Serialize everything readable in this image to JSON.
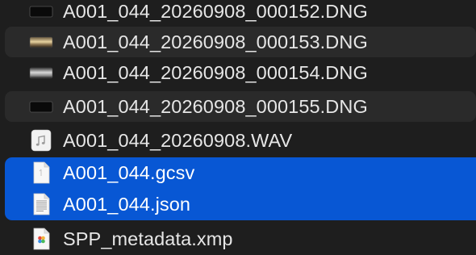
{
  "files": [
    {
      "name": "A001_044_20260908_000152.DNG",
      "icon": "dng-thumbnail-icon"
    },
    {
      "name": "A001_044_20260908_000153.DNG",
      "icon": "dng-thumbnail-icon"
    },
    {
      "name": "A001_044_20260908_000154.DNG",
      "icon": "dng-thumbnail-icon"
    },
    {
      "name": "A001_044_20260908_000155.DNG",
      "icon": "dng-thumbnail-icon"
    },
    {
      "name": "A001_044_20260908.WAV",
      "icon": "audio-file-icon"
    },
    {
      "name": "A001_044.gcsv",
      "icon": "generic-document-icon",
      "selected": true
    },
    {
      "name": "A001_044.json",
      "icon": "text-document-icon",
      "selected": true
    },
    {
      "name": "SPP_metadata.xmp",
      "icon": "xmp-document-icon"
    }
  ],
  "colors": {
    "background": "#1e1e1e",
    "alternate_row": "#2a2a2a",
    "selection": "#0857d4",
    "text": "#e6e6e6"
  }
}
